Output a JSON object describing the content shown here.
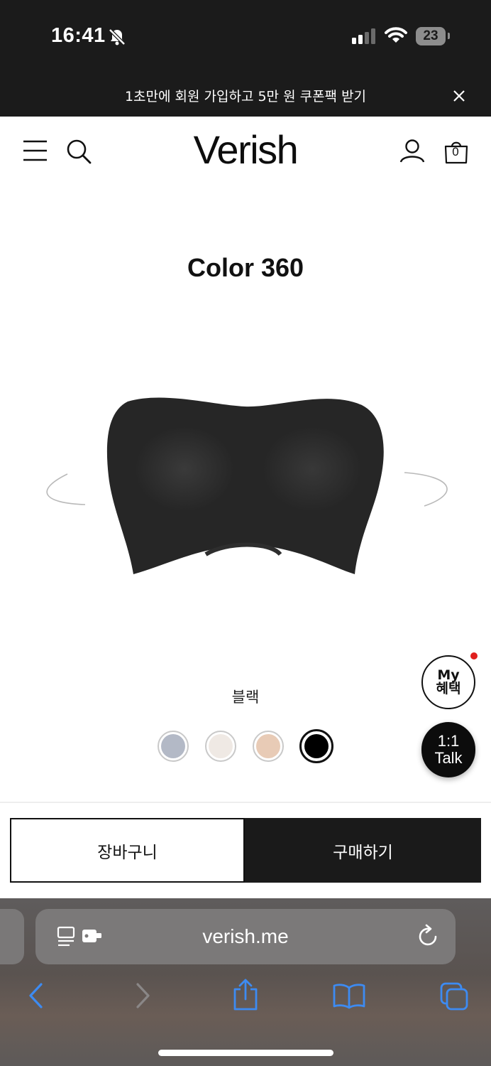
{
  "status_bar": {
    "time": "16:41",
    "battery": "23"
  },
  "banner": {
    "text": "1초만에 회원 가입하고 5만 원 쿠폰팩 받기"
  },
  "header": {
    "logo": "Verish",
    "cart_count": "0"
  },
  "product": {
    "title": "Color 360",
    "color_name": "블랙",
    "color": "#262626",
    "swatches": [
      {
        "name": "gray-blue",
        "color": "#b3b9c6"
      },
      {
        "name": "ivory",
        "color": "#efe9e4"
      },
      {
        "name": "beige",
        "color": "#e8cbb6"
      },
      {
        "name": "black",
        "color": "#000000",
        "selected": true
      }
    ]
  },
  "floating": {
    "my_benefit_line1": "My",
    "my_benefit_line2": "혜택",
    "talk_line1": "1:1",
    "talk_line2": "Talk"
  },
  "actions": {
    "cart_label": "장바구니",
    "buy_label": "구매하기"
  },
  "browser": {
    "url": "verish.me"
  }
}
